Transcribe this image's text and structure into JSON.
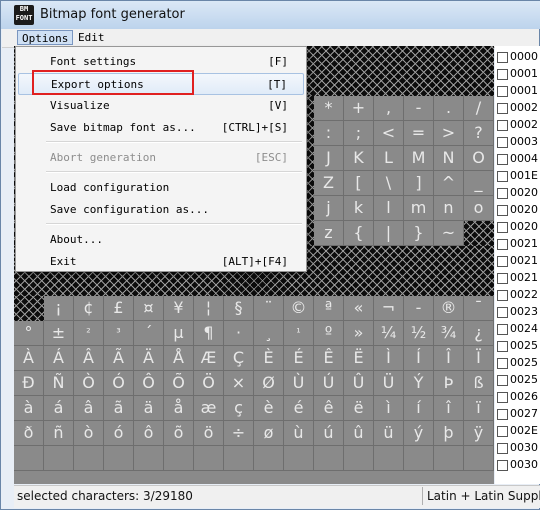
{
  "window": {
    "title": "Bitmap font generator",
    "icon_text_top": "BM",
    "icon_text_bottom": "FONT"
  },
  "menubar": {
    "items": [
      "Options",
      "Edit"
    ]
  },
  "dropdown": {
    "items": [
      {
        "label": "Font settings",
        "shortcut": "[F]",
        "state": "normal"
      },
      {
        "label": "Export options",
        "shortcut": "[T]",
        "state": "hover"
      },
      {
        "label": "Visualize",
        "shortcut": "[V]",
        "state": "normal"
      },
      {
        "label": "Save bitmap font as...",
        "shortcut": "[CTRL]+[S]",
        "state": "normal"
      },
      {
        "label": "Abort generation",
        "shortcut": "[ESC]",
        "state": "disabled"
      },
      {
        "label": "Load configuration",
        "shortcut": "",
        "state": "normal"
      },
      {
        "label": "Save configuration as...",
        "shortcut": "",
        "state": "normal"
      },
      {
        "label": "About...",
        "shortcut": "",
        "state": "normal"
      },
      {
        "label": "Exit",
        "shortcut": "[ALT]+[F4]",
        "state": "normal"
      }
    ]
  },
  "grid": {
    "rows_visible": [
      {
        "row": 2,
        "cells": [
          "",
          "",
          "",
          "",
          "",
          "",
          "",
          "",
          "",
          "",
          "*",
          "+",
          ",",
          "-",
          ".",
          "/"
        ]
      },
      {
        "row": 3,
        "cells": [
          "",
          "",
          "",
          "",
          "",
          "",
          "",
          "",
          "",
          "",
          ":",
          ";",
          "<",
          "=",
          ">",
          "?"
        ]
      },
      {
        "row": 4,
        "cells": [
          "",
          "",
          "",
          "",
          "",
          "",
          "",
          "",
          "",
          "",
          "J",
          "K",
          "L",
          "M",
          "N",
          "O"
        ]
      },
      {
        "row": 5,
        "cells": [
          "",
          "",
          "",
          "",
          "",
          "",
          "",
          "",
          "",
          "",
          "Z",
          "[",
          "\\",
          "]",
          "^",
          "_"
        ]
      },
      {
        "row": 6,
        "cells": [
          "",
          "",
          "",
          "",
          "",
          "",
          "",
          "",
          "",
          "",
          "j",
          "k",
          "l",
          "m",
          "n",
          "o"
        ]
      },
      {
        "row": 7,
        "cells": [
          "",
          "",
          "",
          "",
          "",
          "",
          "",
          "",
          "",
          "",
          "z",
          "{",
          "|",
          "}",
          "~",
          ""
        ]
      },
      {
        "row": 10,
        "cells": [
          "",
          "¡",
          "¢",
          "£",
          "¤",
          "¥",
          "¦",
          "§",
          "¨",
          "©",
          "ª",
          "«",
          "¬",
          "-",
          "®",
          "¯"
        ]
      },
      {
        "row": 11,
        "cells": [
          "°",
          "±",
          "²",
          "³",
          "´",
          "µ",
          "¶",
          "·",
          "¸",
          "¹",
          "º",
          "»",
          "¼",
          "½",
          "¾",
          "¿"
        ]
      },
      {
        "row": 12,
        "cells": [
          "À",
          "Á",
          "Â",
          "Ã",
          "Ä",
          "Å",
          "Æ",
          "Ç",
          "È",
          "É",
          "Ê",
          "Ë",
          "Ì",
          "Í",
          "Î",
          "Ï"
        ]
      },
      {
        "row": 13,
        "cells": [
          "Ð",
          "Ñ",
          "Ò",
          "Ó",
          "Ô",
          "Õ",
          "Ö",
          "×",
          "Ø",
          "Ù",
          "Ú",
          "Û",
          "Ü",
          "Ý",
          "Þ",
          "ß"
        ]
      },
      {
        "row": 14,
        "cells": [
          "à",
          "á",
          "â",
          "ã",
          "ä",
          "å",
          "æ",
          "ç",
          "è",
          "é",
          "ê",
          "ë",
          "ì",
          "í",
          "î",
          "ï"
        ]
      },
      {
        "row": 15,
        "cells": [
          "ð",
          "ñ",
          "ò",
          "ó",
          "ô",
          "õ",
          "ö",
          "÷",
          "ø",
          "ù",
          "ú",
          "û",
          "ü",
          "ý",
          "þ",
          "ÿ"
        ]
      }
    ]
  },
  "right_panel": {
    "items": [
      "0000",
      "0001",
      "0001",
      "0002",
      "0002",
      "0003",
      "0004",
      "001E",
      "0020",
      "0020",
      "0020",
      "0021",
      "0021",
      "0021",
      "0022",
      "0023",
      "0024",
      "0025",
      "0025",
      "0025",
      "0026",
      "0027",
      "002E",
      "0030",
      "0030"
    ]
  },
  "status": {
    "selected": "selected characters: 3/29180",
    "range": "Latin + Latin Supple"
  },
  "colors": {
    "highlight": "#e02020",
    "hover_bg": "#e0ebf8"
  }
}
